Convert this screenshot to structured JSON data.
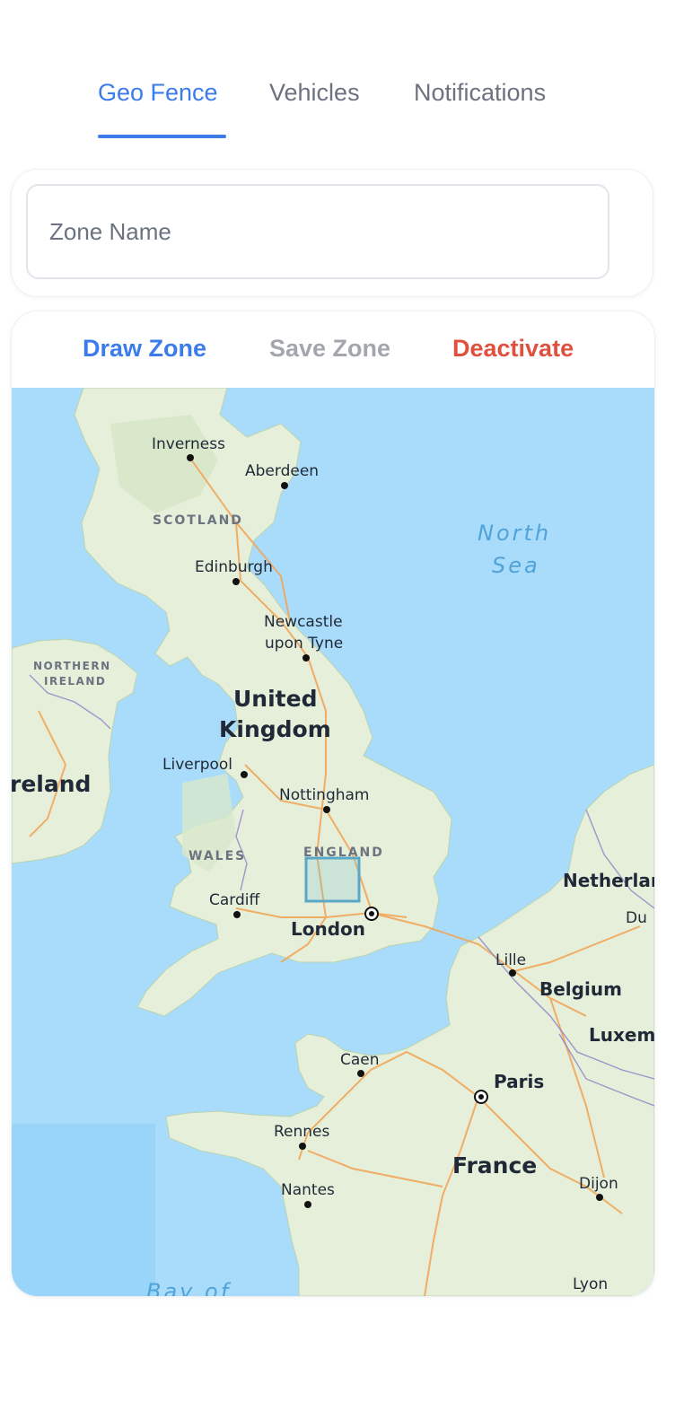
{
  "tabs": [
    {
      "label": "Geo Fence",
      "active": true
    },
    {
      "label": "Vehicles",
      "active": false
    },
    {
      "label": "Notifications",
      "active": false
    }
  ],
  "zone_input": {
    "placeholder": "Zone Name",
    "value": ""
  },
  "actions": {
    "draw_label": "Draw Zone",
    "save_label": "Save Zone",
    "deactivate_label": "Deactivate"
  },
  "colors": {
    "accent": "#3b7bea",
    "muted": "#9ca3af",
    "danger": "#e0503f",
    "sea": "#a9dcfb",
    "land": "#e6efd9",
    "zone": "#5aa8c8"
  },
  "map": {
    "labels": {
      "inverness": "Inverness",
      "aberdeen": "Aberdeen",
      "scotland": "SCOTLAND",
      "north": "North",
      "sea": "Sea",
      "edinburgh": "Edinburgh",
      "newcastle_1": "Newcastle",
      "newcastle_2": "upon Tyne",
      "northern": "NORTHERN",
      "ireland_region": "IRELAND",
      "united": "United",
      "kingdom": "Kingdom",
      "liverpool": "Liverpool",
      "ireland": "reland",
      "nottingham": "Nottingham",
      "wales": "WALES",
      "england": "ENGLAND",
      "netherlands": "Netherlar",
      "du": "Du",
      "cardiff": "Cardiff",
      "london": "London",
      "lille": "Lille",
      "belgium": "Belgium",
      "luxembourg": "Luxeml",
      "caen": "Caen",
      "paris": "Paris",
      "rennes": "Rennes",
      "france": "France",
      "nantes": "Nantes",
      "dijon": "Dijon",
      "lyon": "Lyon",
      "bay_of": "Bay of"
    }
  }
}
